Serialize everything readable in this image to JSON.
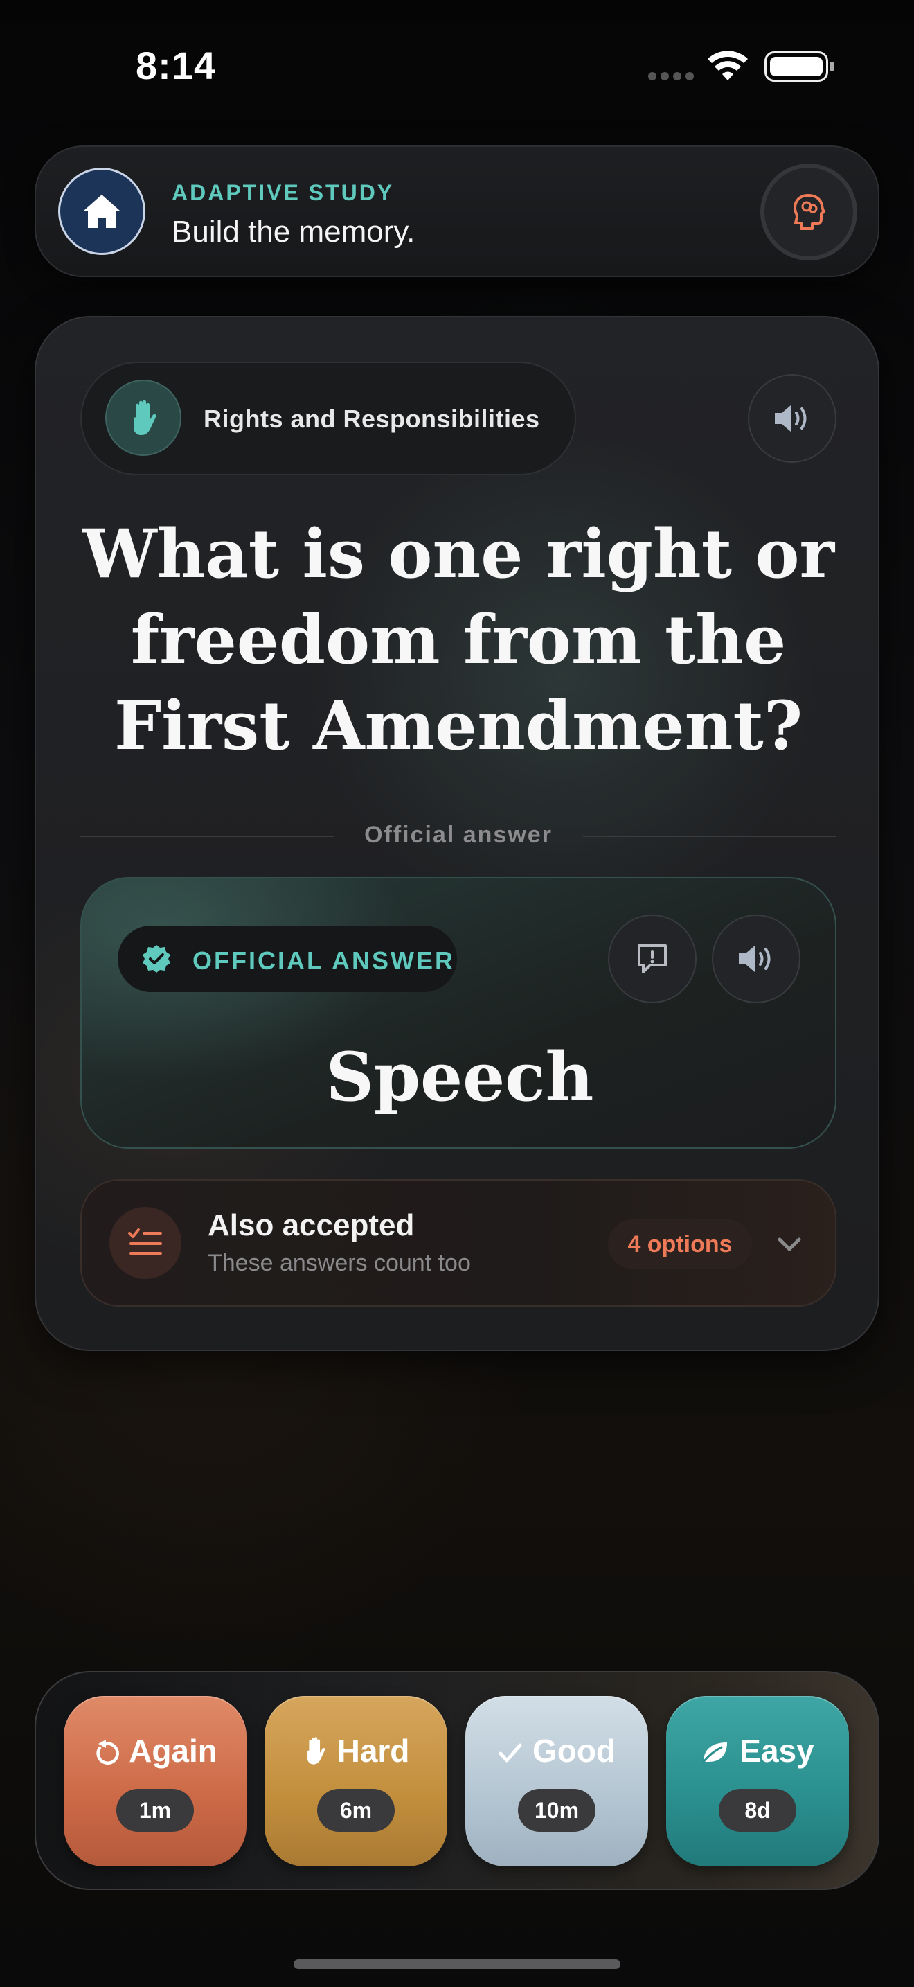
{
  "status_bar": {
    "time": "8:14"
  },
  "header": {
    "eyebrow": "ADAPTIVE STUDY",
    "title": "Build the memory.",
    "home_icon": "house-icon",
    "brain_icon": "head-brain-icon"
  },
  "card": {
    "category": "Rights and Responsibilities",
    "category_icon": "raised-hand-icon",
    "question": "What is one right or freedom from the First Amendment?",
    "divider_label": "Official answer",
    "answer": {
      "badge_label": "OFFICIAL ANSWER",
      "text": "Speech"
    },
    "also_accepted": {
      "title": "Also accepted",
      "subtitle": "These answers count too",
      "badge": "4 options"
    }
  },
  "rating": [
    {
      "label": "Again",
      "interval": "1m",
      "icon": "undo-arrow-icon",
      "color": "#cc6946"
    },
    {
      "label": "Hard",
      "interval": "6m",
      "icon": "raised-hand-icon",
      "color": "#c28e3c"
    },
    {
      "label": "Good",
      "interval": "10m",
      "icon": "checkmark-icon",
      "color": "#b4c5d2"
    },
    {
      "label": "Easy",
      "interval": "8d",
      "icon": "leaf-icon",
      "color": "#2a8f8e"
    }
  ],
  "colors": {
    "accent": "#5ec9bc",
    "warm_accent": "#ef7a58"
  }
}
